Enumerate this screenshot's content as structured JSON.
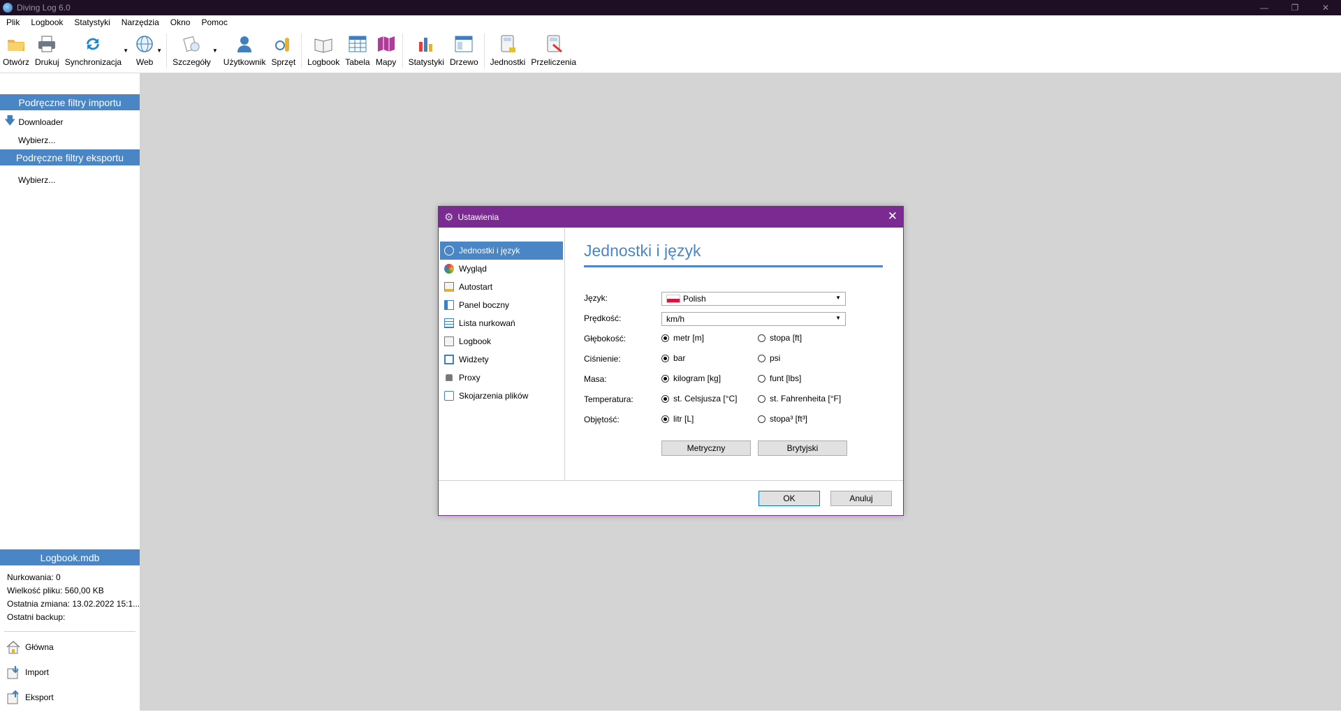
{
  "app": {
    "title": "Diving Log 6.0"
  },
  "menu": [
    "Plik",
    "Logbook",
    "Statystyki",
    "Narzędzia",
    "Okno",
    "Pomoc"
  ],
  "toolbar": {
    "open": "Otwórz",
    "print": "Drukuj",
    "sync": "Synchronizacja",
    "web": "Web",
    "details": "Szczegóły",
    "user": "Użytkownik",
    "equipment": "Sprzęt",
    "logbook": "Logbook",
    "table": "Tabela",
    "maps": "Mapy",
    "stats": "Statystyki",
    "tree": "Drzewo",
    "units": "Jednostki",
    "calc": "Przeliczenia"
  },
  "sidebar": {
    "import_header": "Podręczne filtry importu",
    "downloader": "Downloader",
    "import_choose": "Wybierz...",
    "export_header": "Podręczne filtry eksportu",
    "export_choose": "Wybierz...",
    "db_header": "Logbook.mdb",
    "dives": "Nurkowania: 0",
    "filesize": "Wielkość pliku: 560,00 KB",
    "lastchange": "Ostatnia zmiana: 13.02.2022 15:1...",
    "lastbackup": "Ostatni backup:",
    "nav_home": "Główna",
    "nav_import": "Import",
    "nav_export": "Eksport"
  },
  "dialog": {
    "title": "Ustawienia",
    "nav": [
      "Jednostki i język",
      "Wygląd",
      "Autostart",
      "Panel boczny",
      "Lista nurkowań",
      "Logbook",
      "Widżety",
      "Proxy",
      "Skojarzenia plików"
    ],
    "heading": "Jednostki i język",
    "language_label": "Język:",
    "language_value": "Polish",
    "speed_label": "Prędkość:",
    "speed_value": "km/h",
    "depth_label": "Głębokość:",
    "depth_opt1": "metr [m]",
    "depth_opt2": "stopa [ft]",
    "pressure_label": "Ciśnienie:",
    "pressure_opt1": "bar",
    "pressure_opt2": "psi",
    "mass_label": "Masa:",
    "mass_opt1": "kilogram [kg]",
    "mass_opt2": "funt [lbs]",
    "temp_label": "Temperatura:",
    "temp_opt1": "st. Celsjusza [°C]",
    "temp_opt2": "st. Fahrenheita [°F]",
    "volume_label": "Objętość:",
    "volume_opt1": "litr [L]",
    "volume_opt2": "stopa³ [ft³]",
    "metric_btn": "Metryczny",
    "imperial_btn": "Brytyjski",
    "ok_btn": "OK",
    "cancel_btn": "Anuluj"
  },
  "colors": {
    "accent": "#4a86c5",
    "dialog_title": "#7a2a90",
    "titlebar": "#1e0f24"
  }
}
